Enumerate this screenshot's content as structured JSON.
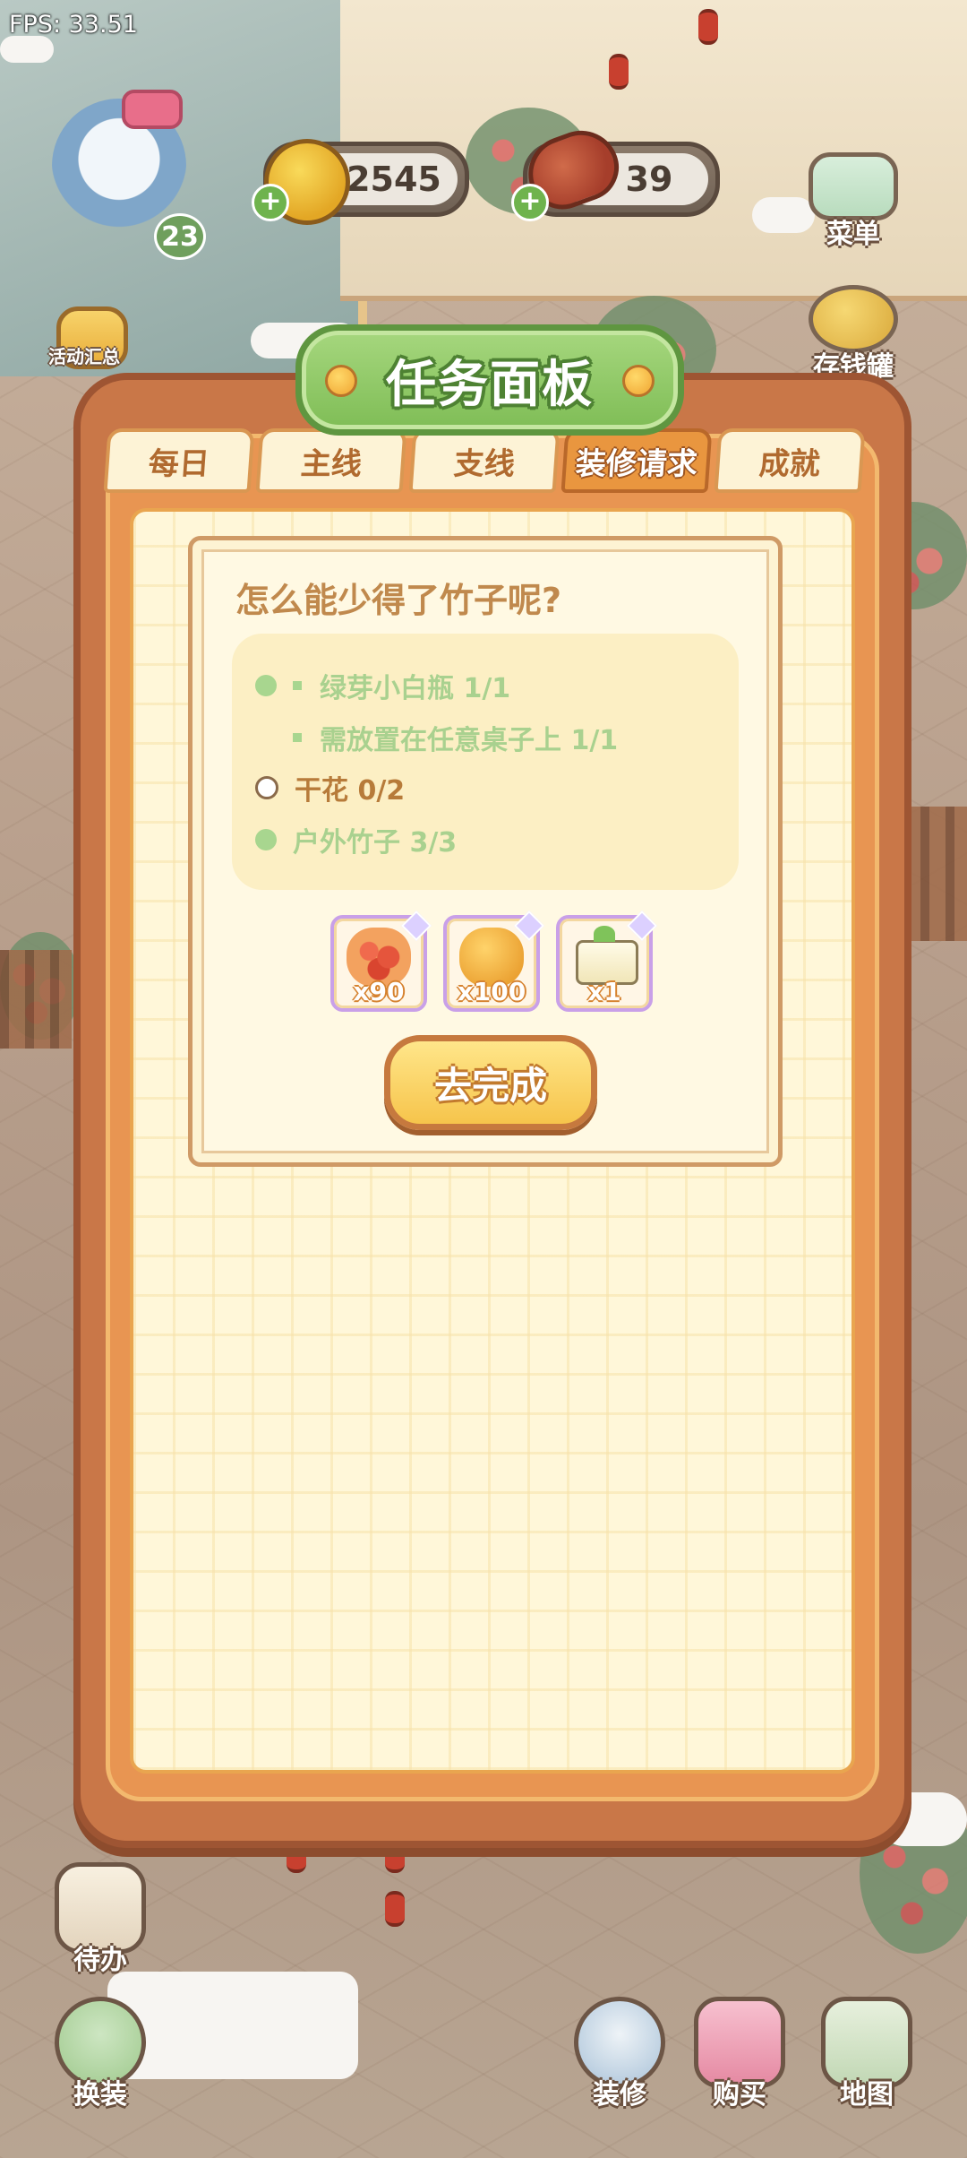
{
  "hud": {
    "fps": "FPS: 33.51",
    "level": "23",
    "coins": "2545",
    "food": "39"
  },
  "side_left": {
    "events_label": "活动汇总"
  },
  "side_right": {
    "menu_label": "菜单",
    "moneybag_label": "存钱罐"
  },
  "panel": {
    "title": "任务面板",
    "tabs": [
      {
        "label": "每日",
        "active": false
      },
      {
        "label": "主线",
        "active": false
      },
      {
        "label": "支线",
        "active": false
      },
      {
        "label": "装修请求",
        "active": true
      },
      {
        "label": "成就",
        "active": false
      }
    ]
  },
  "quest": {
    "title": "怎么能少得了竹子呢?",
    "requirements": [
      {
        "text": "绿芽小白瓶 1/1",
        "done": true
      },
      {
        "text": "需放置在任意桌子上 1/1",
        "done": true
      },
      {
        "text": "干花 0/2",
        "done": false
      },
      {
        "text": "户外竹子 3/3",
        "done": true
      }
    ],
    "rewards": [
      {
        "icon": "roses-pile-icon",
        "qty": "x90"
      },
      {
        "icon": "gold-coins-icon",
        "qty": "x100"
      },
      {
        "icon": "sprout-box-icon",
        "qty": "x1"
      }
    ],
    "go_button": "去完成"
  },
  "bottom": {
    "todo": "待办",
    "outfit": "换装",
    "decorate": "装修",
    "buy": "购买",
    "map": "地图"
  },
  "colors": {
    "panel_orange": "#c97748",
    "title_green": "#7fbd56",
    "done_green": "#a8d68f",
    "pending_brown": "#b77b3a"
  }
}
